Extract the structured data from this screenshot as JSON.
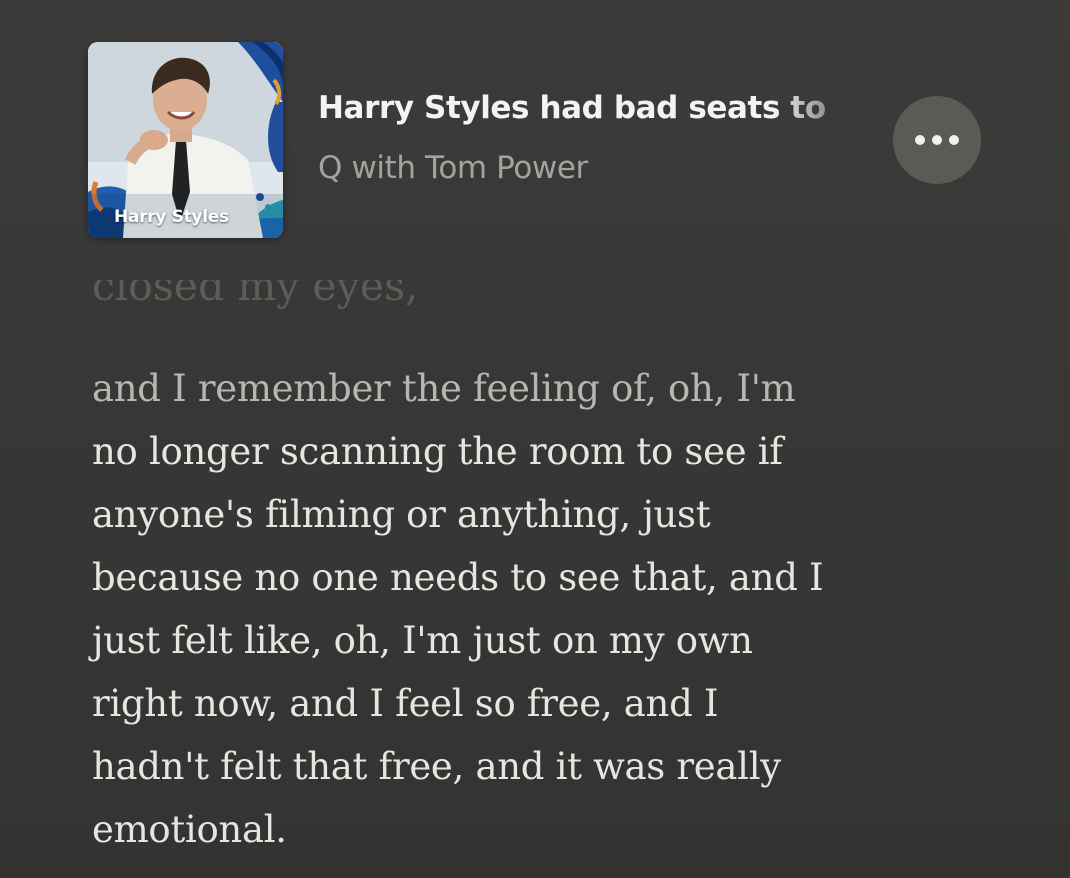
{
  "colors": {
    "background": "#383735",
    "title": "#f3f3f3",
    "subtitle": "#a3a29f",
    "transcript_text": "#e6e5e2",
    "transcript_dim": "#b7b6b2",
    "button_bg": "#5b5a57"
  },
  "episode": {
    "artwork_caption": "Harry Styles",
    "title": "Harry Styles had bad seats to",
    "show": "Q with Tom Power"
  },
  "more_button": {
    "icon": "ellipsis-icon"
  },
  "transcript": {
    "previous_line": "closed my eyes,",
    "lines": [
      "and I remember the feeling of, oh, I'm",
      "no longer scanning the room to see if",
      "anyone's filming or anything, just",
      "because no one needs to see that, and I",
      "just felt like, oh, I'm just on my own",
      "right now, and I feel so free, and I",
      "hadn't felt that free, and it was really",
      "emotional."
    ]
  }
}
